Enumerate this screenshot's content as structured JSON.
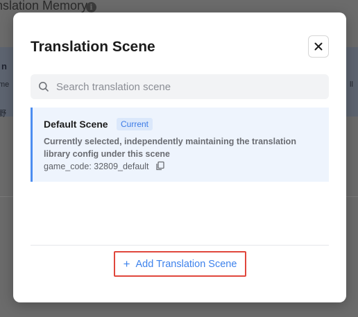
{
  "background": {
    "title": "nslation Memory",
    "band_text": "n",
    "band_sub": "me",
    "band_sub2": "野",
    "right_fragment": "ll"
  },
  "modal": {
    "title": "Translation Scene",
    "search": {
      "placeholder": "Search translation scene",
      "value": ""
    },
    "scenes": [
      {
        "name": "Default Scene",
        "tag": "Current",
        "description": "Currently selected, independently maintaining the translation library config under this scene",
        "code": "game_code: 32809_default"
      }
    ],
    "add_button_label": "Add Translation Scene"
  },
  "colors": {
    "accent": "#3d82ec",
    "selected_bg": "#eef4fd",
    "highlight_border": "#e0463b"
  },
  "icons": [
    "info-icon",
    "close-icon",
    "search-icon",
    "copy-icon",
    "plus-icon"
  ]
}
